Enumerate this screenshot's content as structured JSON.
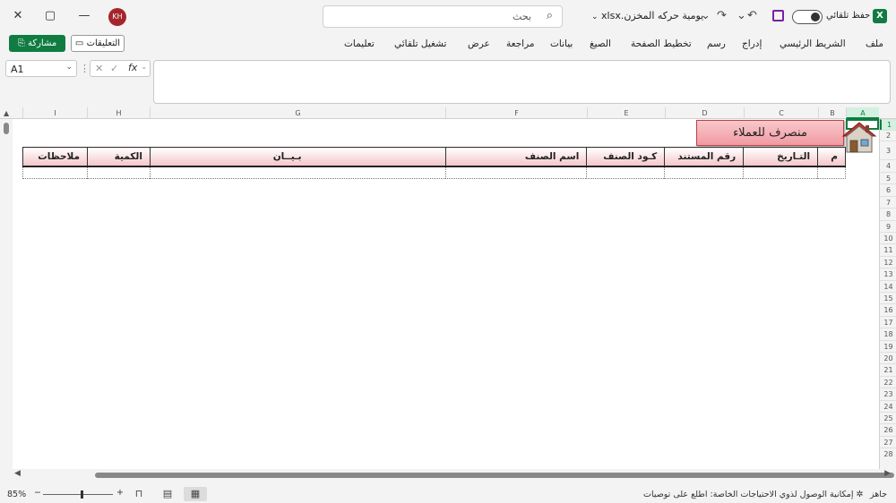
{
  "titlebar": {
    "avatar_initials": "KH",
    "search_placeholder": "بحث",
    "filename": "يومية حركه المخزن.xlsx",
    "autosave_label": "حفظ تلقائي",
    "close_glyph": "✕",
    "restore_glyph": "▢",
    "minimize_glyph": "—",
    "app_logo": "X"
  },
  "ribbon": {
    "share_label": "مشاركة",
    "comments_label": "التعليقات",
    "tabs": [
      "ملف",
      "الشريط الرئيسي",
      "إدراج",
      "رسم",
      "تخطيط الصفحة",
      "الصيغ",
      "بيانات",
      "مراجعة",
      "عرض",
      "تشغيل تلقائي",
      "تعليمات"
    ]
  },
  "formula_bar": {
    "name_box": "A1",
    "fx_label": "fx",
    "value": ""
  },
  "grid": {
    "columns": [
      "A",
      "B",
      "C",
      "D",
      "E",
      "F",
      "G",
      "H",
      "I"
    ],
    "rows": [
      "1",
      "2",
      "3",
      "4",
      "5",
      "6",
      "7",
      "8",
      "9",
      "10",
      "11",
      "12",
      "13",
      "14",
      "15",
      "16",
      "17",
      "18",
      "19",
      "20",
      "21",
      "22",
      "23",
      "24",
      "25",
      "26",
      "27",
      "28"
    ],
    "selected_cell": "A1"
  },
  "sheet": {
    "title": "منصرف للعملاء",
    "headers": [
      "م",
      "التـاريخ",
      "رقم المستند",
      "كـود الصنف",
      "اسم الصنف",
      "بـيــان",
      "الكمية",
      "ملاحظات"
    ]
  },
  "statusbar": {
    "ready": "جاهز",
    "accessibility": "إمكانية الوصول لذوي الاحتياجات الخاصة: اطلع على توصيات",
    "zoom": "85%"
  },
  "colors": {
    "accent": "#107c41",
    "header_pink": "#f4c4c8",
    "title_pink": "#f19aa2"
  }
}
